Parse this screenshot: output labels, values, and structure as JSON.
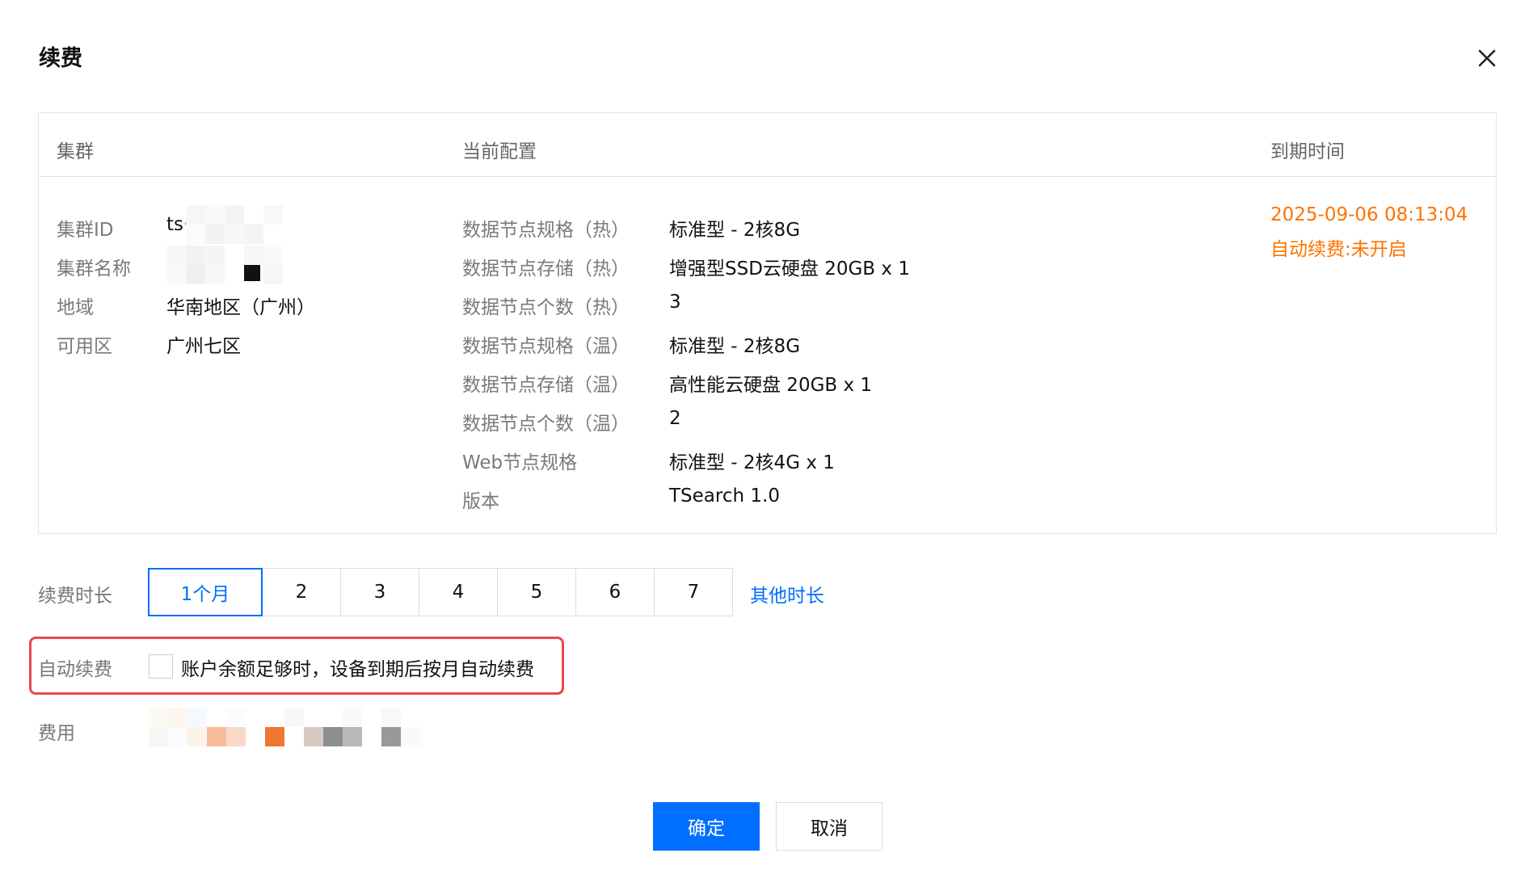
{
  "dialog": {
    "title": "续费",
    "close_icon": "close-icon"
  },
  "table": {
    "headers": {
      "cluster": "集群",
      "config": "当前配置",
      "expire": "到期时间"
    },
    "cluster_info": [
      {
        "label": "集群ID",
        "value": "ts·"
      },
      {
        "label": "集群名称",
        "value": ""
      },
      {
        "label": "地域",
        "value": "华南地区（广州）"
      },
      {
        "label": "可用区",
        "value": "广州七区"
      }
    ],
    "config_rows": [
      {
        "label": "数据节点规格（热）",
        "value": "标准型 - 2核8G"
      },
      {
        "label": "数据节点存储（热）",
        "value": "增强型SSD云硬盘 20GB x 1"
      },
      {
        "label": "数据节点个数（热）",
        "value": "3"
      },
      {
        "label": "数据节点规格（温）",
        "value": "标准型 - 2核8G"
      },
      {
        "label": "数据节点存储（温）",
        "value": "高性能云硬盘 20GB x 1"
      },
      {
        "label": "数据节点个数（温）",
        "value": "2"
      },
      {
        "label": "Web节点规格",
        "value": "标准型 - 2核4G x 1"
      },
      {
        "label": "版本",
        "value": "TSearch 1.0"
      }
    ],
    "expire": {
      "date": "2025-09-06 08:13:04",
      "auto_renew_status": "自动续费:未开启"
    }
  },
  "form": {
    "duration_label": "续费时长",
    "duration_options": [
      "1个月",
      "2",
      "3",
      "4",
      "5",
      "6",
      "7"
    ],
    "selected_duration": "1个月",
    "other_duration": "其他时长",
    "auto_renew_label": "自动续费",
    "auto_renew_checkbox_text": "账户余额足够时，设备到期后按月自动续费",
    "auto_renew_checked": false,
    "fee_label": "费用"
  },
  "actions": {
    "confirm": "确定",
    "cancel": "取消"
  },
  "colors": {
    "primary": "#006eff",
    "warning": "#ff7200",
    "highlight": "#e6494e"
  }
}
